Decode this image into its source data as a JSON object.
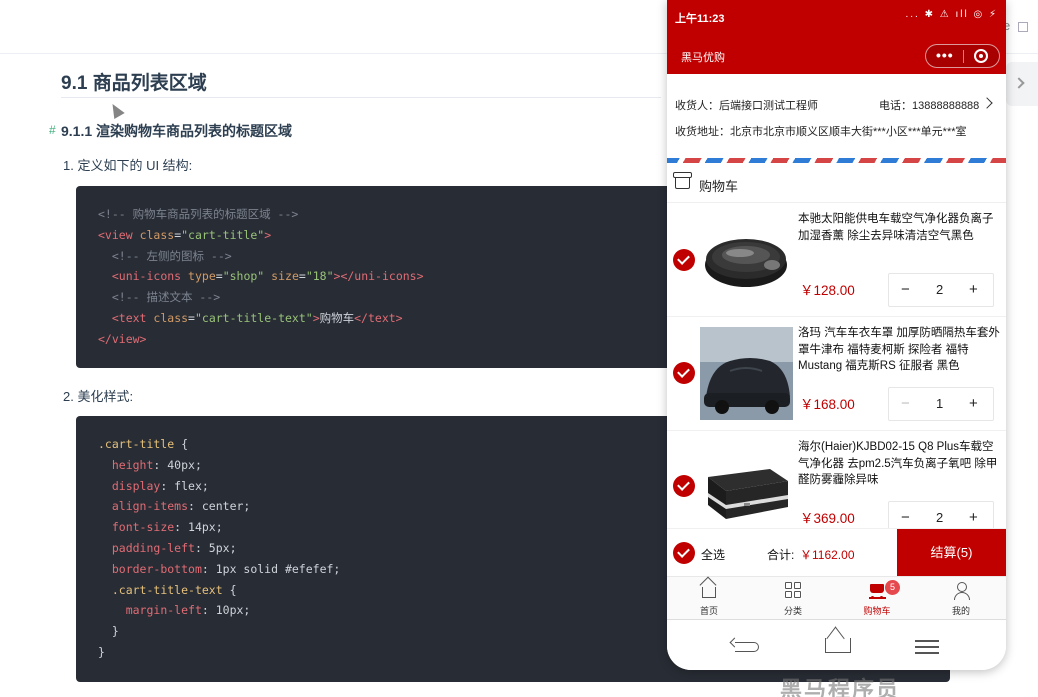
{
  "doc": {
    "topbar_fragment": "e",
    "h2": "9.1 商品列表区域",
    "h3_anchor": "#",
    "h3": "9.1.1 渲染购物车商品列表的标题区域",
    "step1": "1. 定义如下的 UI 结构:",
    "step2": "2. 美化样式:",
    "watermark": "黑马程序员"
  },
  "phone": {
    "status": {
      "time": "上午11:23",
      "icons": "... ✱ ⚠ ıll ◎ ⚡"
    },
    "navbar": {
      "title": "黑马优购",
      "capsule_dots": "•••"
    },
    "address": {
      "receiver": "收货人：后端接口测试工程师",
      "phone": "电话：13888888888",
      "address": "收货地址：北京市北京市顺义区顺丰大街***小区***单元***室"
    },
    "cart_title": "购物车",
    "goods": [
      {
        "name": "本驰太阳能供电车载空气净化器负离子加湿香薰 除尘去异味清洁空气黑色",
        "price": "￥128.00",
        "minus": "−",
        "count": "2",
        "plus": "+",
        "picture": "air-purifier"
      },
      {
        "name": "洛玛 汽车车衣车罩 加厚防晒隔热车套外罩牛津布 福特麦柯斯 探险者 福特 Mustang 福克斯RS 征服者 黑色",
        "price": "￥168.00",
        "minus": "−",
        "count": "1",
        "plus": "+",
        "picture": "car-cover"
      },
      {
        "name": "海尔(Haier)KJBD02-15 Q8 Plus车载空气净化器 去pm2.5汽车负离子氧吧 除甲醛防雾霾除异味",
        "price": "￥369.00",
        "minus": "−",
        "count": "2",
        "plus": "+",
        "picture": "air-purifier-box"
      }
    ],
    "settle": {
      "select_all": "全选",
      "total_label": "合计:",
      "total_amount": "￥1162.00",
      "button": "结算(5)"
    },
    "tabbar": [
      {
        "label": "首页",
        "icon": "home-icon"
      },
      {
        "label": "分类",
        "icon": "category-icon"
      },
      {
        "label": "购物车",
        "icon": "cart-icon",
        "badge": "5"
      },
      {
        "label": "我的",
        "icon": "user-icon"
      }
    ],
    "accent_color": "#c00000"
  }
}
